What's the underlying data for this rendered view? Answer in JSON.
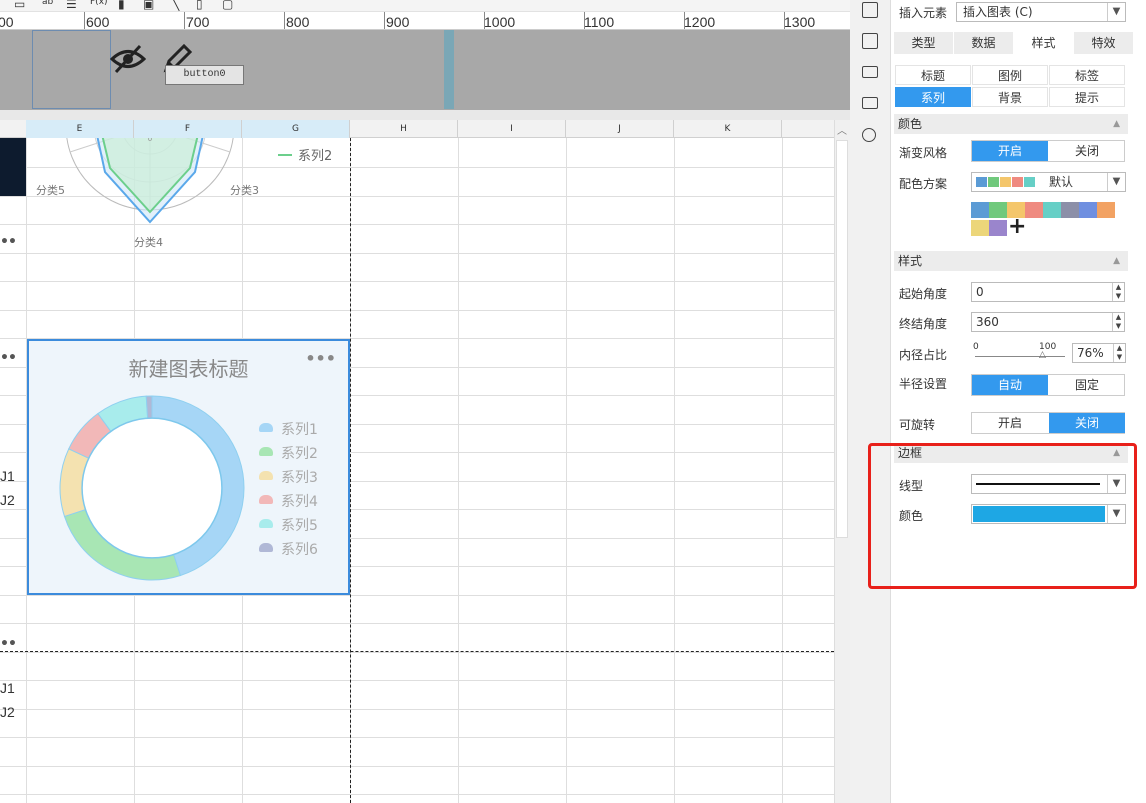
{
  "ruler": {
    "labels": [
      "00",
      "600",
      "700",
      "800",
      "900",
      "1000",
      "1100",
      "1200",
      "1300"
    ]
  },
  "canvas_button": {
    "label": "button0"
  },
  "columns": [
    "E",
    "F",
    "G",
    "H",
    "I",
    "J",
    "K"
  ],
  "row_labels": {
    "a": "J1",
    "b": "J2",
    "c": "J1",
    "d": "J2"
  },
  "radar": {
    "series2": "系列2",
    "cat5": "分类5",
    "cat3": "分类3",
    "cat4": "分类4",
    "cat0": "0"
  },
  "chart": {
    "title": "新建图表标题",
    "legend": [
      "系列1",
      "系列2",
      "系列3",
      "系列4",
      "系列5",
      "系列6"
    ],
    "legend_colors": [
      "#a6d6f6",
      "#a8e6b4",
      "#f4e2b0",
      "#f2b8b8",
      "#a8ecec",
      "#b0b8d6"
    ]
  },
  "chart_data": {
    "type": "pie",
    "title": "新建图表标题",
    "innerRadiusPercent": 76,
    "series": [
      {
        "name": "系列1",
        "value": 45
      },
      {
        "name": "系列2",
        "value": 25
      },
      {
        "name": "系列3",
        "value": 12
      },
      {
        "name": "系列4",
        "value": 8
      },
      {
        "name": "系列5",
        "value": 9
      },
      {
        "name": "系列6",
        "value": 1
      }
    ],
    "colors": [
      "#a6d6f6",
      "#a8e6b4",
      "#f4e2b0",
      "#f2b8b8",
      "#a8ecec",
      "#b0b8d6"
    ]
  },
  "panel": {
    "insert_label": "插入元素",
    "insert_value": "插入图表 (C)",
    "tabs": [
      "类型",
      "数据",
      "样式",
      "特效"
    ],
    "subtabs": [
      "标题",
      "图例",
      "标签",
      "系列",
      "背景",
      "提示"
    ],
    "sec_color": "颜色",
    "gradient_label": "渐变风格",
    "gradient_on": "开启",
    "gradient_off": "关闭",
    "scheme_label": "配色方案",
    "scheme_value": "默认",
    "scheme_swatches": [
      "#5b9bd5",
      "#70c97c",
      "#f4c66b",
      "#ef8a80",
      "#66cfc6",
      "#8c8fa8",
      "#6f8fe0",
      "#f2a263",
      "#ecd67a",
      "#9a85cc"
    ],
    "plus": "+",
    "sec_style": "样式",
    "start_label": "起始角度",
    "start_value": "0",
    "end_label": "终结角度",
    "end_value": "360",
    "inner_label": "内径占比",
    "inner_min": "0",
    "inner_max": "100",
    "inner_value": "76%",
    "radius_label": "半径设置",
    "radius_auto": "自动",
    "radius_fixed": "固定",
    "rotate_label": "可旋转",
    "rotate_on": "开启",
    "rotate_off": "关闭",
    "sec_border": "边框",
    "linetype_label": "线型",
    "border_color_label": "颜色",
    "border_color": "#1ea7e4"
  }
}
